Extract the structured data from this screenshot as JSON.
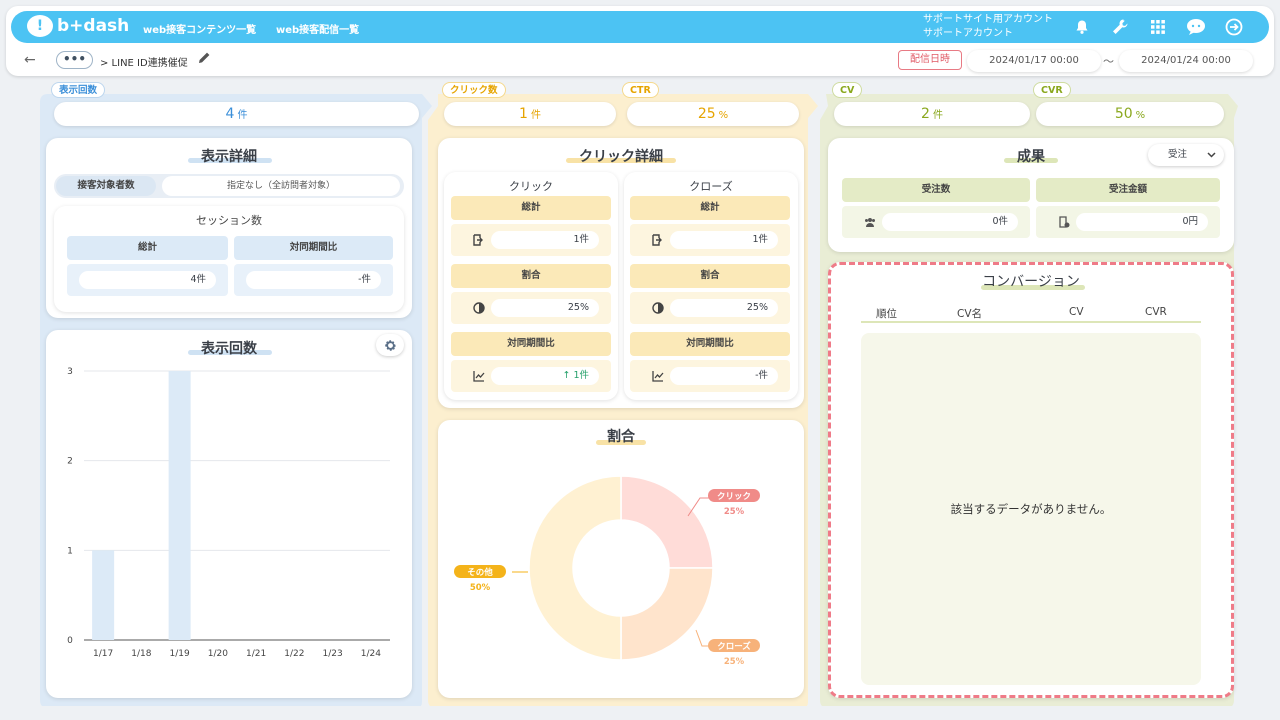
{
  "header": {
    "logo_text": "b+dash",
    "nav": [
      "web接客コンテンツ一覧",
      "web接客配信一覧"
    ],
    "account_line1": "サポートサイト用アカウント",
    "account_line2": "サポートアカウント"
  },
  "subbar": {
    "dots": "•••",
    "breadcrumb": "> LINE ID連携催促",
    "date_label": "配信日時",
    "date_from": "2024/01/17 00:00",
    "tilde": "〜",
    "date_to": "2024/01/24 00:00"
  },
  "kpis": {
    "impressions": {
      "label": "表示回数",
      "value": "4",
      "unit": "件"
    },
    "clicks": {
      "label": "クリック数",
      "value": "1",
      "unit": "件"
    },
    "ctr": {
      "label": "CTR",
      "value": "25",
      "unit": "%"
    },
    "cv": {
      "label": "CV",
      "value": "2",
      "unit": "件"
    },
    "cvr": {
      "label": "CVR",
      "value": "50",
      "unit": "%"
    }
  },
  "display_detail": {
    "title": "表示詳細",
    "target_label": "接客対象者数",
    "target_value": "指定なし（全訪問者対象）",
    "session_title": "セッション数",
    "total_label": "総計",
    "total_value": "4件",
    "compare_label": "対同期間比",
    "compare_value": "-件"
  },
  "impression_chart": {
    "title": "表示回数"
  },
  "chart_data": {
    "type": "bar",
    "title": "表示回数",
    "categories": [
      "1/17",
      "1/18",
      "1/19",
      "1/20",
      "1/21",
      "1/22",
      "1/23",
      "1/24"
    ],
    "values": [
      1,
      0,
      3,
      0,
      0,
      0,
      0,
      0
    ],
    "yticks": [
      "0",
      "1",
      "2",
      "3"
    ],
    "ylim": [
      0,
      3
    ],
    "grid": true,
    "color": "#dceaf7"
  },
  "click_detail": {
    "title": "クリック詳細",
    "click": {
      "title": "クリック",
      "total_label": "総計",
      "total_value": "1件",
      "ratio_label": "割合",
      "ratio_value": "25%",
      "compare_label": "対同期間比",
      "compare_value": "↑ 1件"
    },
    "close": {
      "title": "クローズ",
      "total_label": "総計",
      "total_value": "1件",
      "ratio_label": "割合",
      "ratio_value": "25%",
      "compare_label": "対同期間比",
      "compare_value": "-件"
    }
  },
  "ratio_chart": {
    "title": "割合",
    "slices": [
      {
        "name": "クリック",
        "value": 25,
        "label": "25%",
        "color": "#ffdcd8",
        "tag_color": "#f08b88"
      },
      {
        "name": "クローズ",
        "value": 25,
        "label": "25%",
        "color": "#ffe4cc",
        "tag_color": "#f7b27a"
      },
      {
        "name": "その他",
        "value": 50,
        "label": "50%",
        "color": "#fff1d2",
        "tag_color": "#f4b31a"
      }
    ]
  },
  "results": {
    "title": "成果",
    "select_value": "受注",
    "orders_label": "受注数",
    "orders_value": "0件",
    "amount_label": "受注金額",
    "amount_value": "0円"
  },
  "conversion": {
    "title": "コンバージョン",
    "columns": [
      "順位",
      "CV名",
      "CV",
      "CVR"
    ],
    "empty": "該当するデータがありません。"
  },
  "colors": {
    "blue_bg": "#dce9f6",
    "yellow_bg": "#fcefcf",
    "green_bg": "#e9edd5",
    "blue_text": "#3b8fd9",
    "yellow_text": "#e6a400",
    "green_text": "#8aa81e",
    "red_dash": "#ef7b88"
  }
}
